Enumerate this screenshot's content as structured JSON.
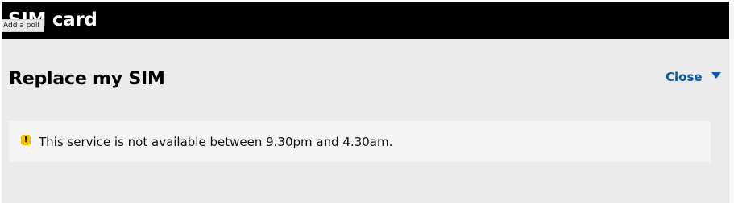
{
  "header": {
    "title": "SIM card"
  },
  "tooltip": {
    "text": "Add a poll"
  },
  "section": {
    "title": "Replace my SIM",
    "close_label": "Close",
    "close_icon": "chevron-down-icon"
  },
  "notice": {
    "icon": "warning-icon",
    "icon_glyph": "!",
    "message": "This service is not available between 9.30pm and 4.30am."
  },
  "colors": {
    "header_bg": "#000000",
    "panel_bg": "#ebebeb",
    "notice_bg": "#f4f4f4",
    "link": "#0b5aa8",
    "warning": "#f2c200"
  }
}
